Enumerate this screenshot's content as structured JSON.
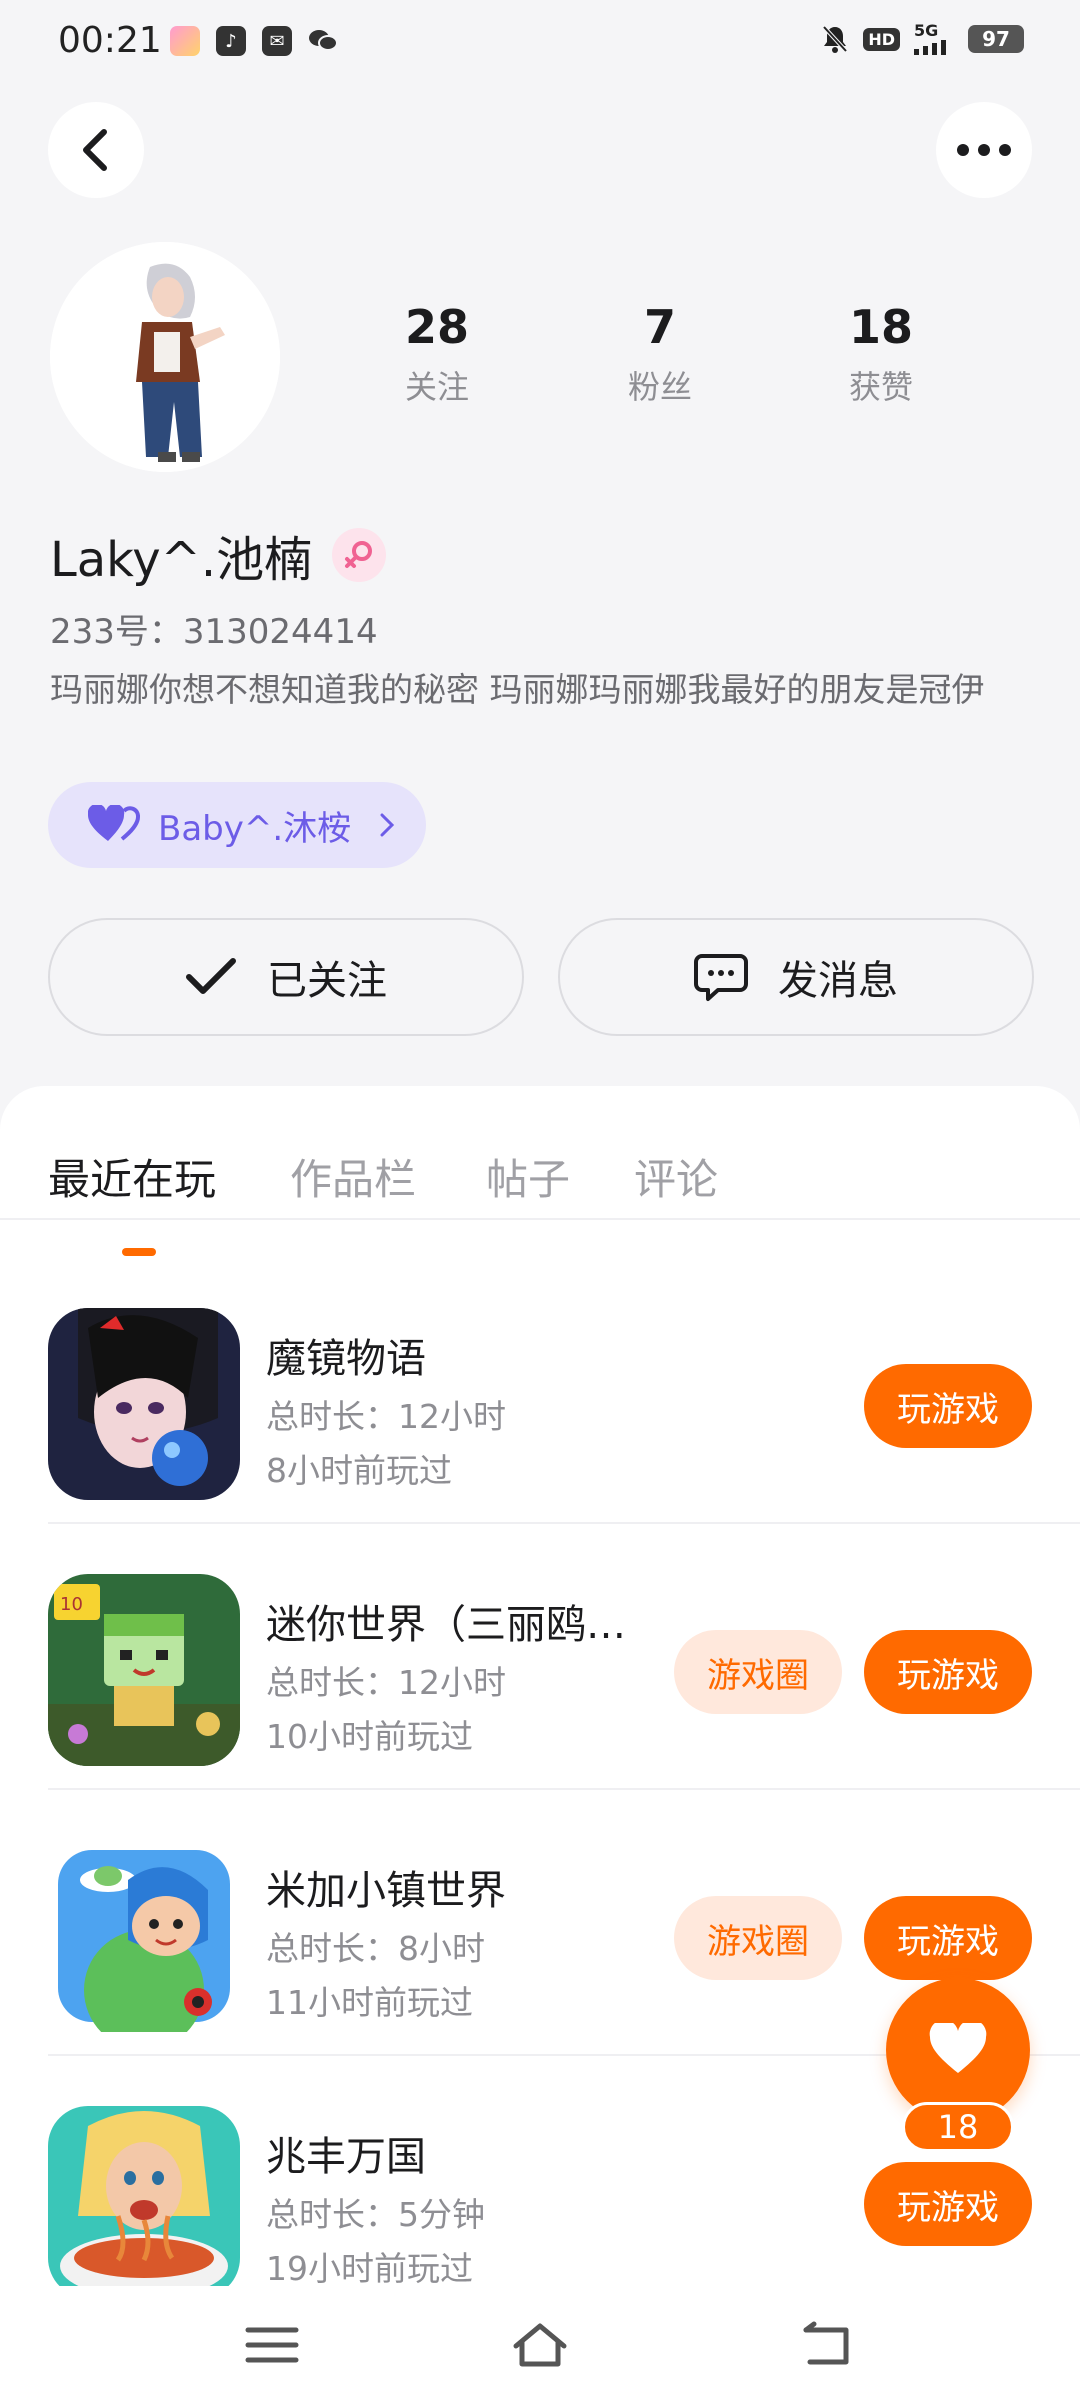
{
  "status_bar": {
    "time": "00:21",
    "battery": "97",
    "hd": "HD",
    "network": "5G",
    "apps": [
      "photo-app-icon",
      "tiktok-icon",
      "mail-icon",
      "wechat-icon"
    ]
  },
  "profile": {
    "stats": [
      {
        "count": "28",
        "label": "关注"
      },
      {
        "count": "7",
        "label": "粉丝"
      },
      {
        "count": "18",
        "label": "获赞"
      }
    ],
    "name": "Laky^.池楠",
    "uid": "233号：313024414",
    "bio": "玛丽娜你想不想知道我的秘密 玛丽娜玛丽娜我最好的朋友是冠伊",
    "partner": "Baby^.沐桉",
    "follow_label": "已关注",
    "message_label": "发消息"
  },
  "tabs": [
    "最近在玩",
    "作品栏",
    "帖子",
    "评论"
  ],
  "games": [
    {
      "name": "魔镜物语",
      "duration": "总时长：12小时",
      "last_played": "8小时前玩过",
      "play_label": "玩游戏",
      "circle_label": ""
    },
    {
      "name": "迷你世界（三丽鸥…",
      "duration": "总时长：12小时",
      "last_played": "10小时前玩过",
      "play_label": "玩游戏",
      "circle_label": "游戏圈"
    },
    {
      "name": "米加小镇世界",
      "duration": "总时长：8小时",
      "last_played": "11小时前玩过",
      "play_label": "玩游戏",
      "circle_label": "游戏圈"
    },
    {
      "name": "兆丰万国",
      "duration": "总时长：5分钟",
      "last_played": "19小时前玩过",
      "play_label": "玩游戏",
      "circle_label": ""
    }
  ],
  "like_count": "18",
  "colors": {
    "accent": "#ff6a00",
    "accent_light": "#ffe8dc",
    "partner_bg": "#e6e3fb",
    "partner_text": "#6c5ce7"
  }
}
